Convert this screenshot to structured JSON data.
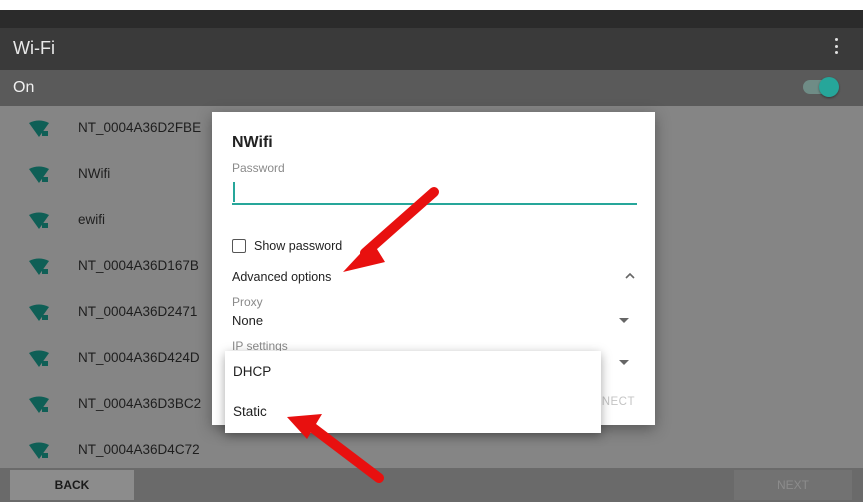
{
  "appbar": {
    "title": "Wi-Fi",
    "menu_icon": "more-vert-icon"
  },
  "wifi_toggle": {
    "label": "On",
    "state": "on"
  },
  "networks": [
    {
      "name": "NT_0004A36D2FBE"
    },
    {
      "name": "NWifi"
    },
    {
      "name": "ewifi"
    },
    {
      "name": "NT_0004A36D167B"
    },
    {
      "name": "NT_0004A36D2471"
    },
    {
      "name": "NT_0004A36D424D"
    },
    {
      "name": "NT_0004A36D3BC2"
    },
    {
      "name": "NT_0004A36D4C72"
    }
  ],
  "bottom": {
    "back_label": "BACK",
    "next_label": "NEXT"
  },
  "dialog": {
    "title": "NWifi",
    "password_label": "Password",
    "password_value": "",
    "show_password_label": "Show password",
    "advanced_label": "Advanced options",
    "proxy_label": "Proxy",
    "proxy_value": "None",
    "ip_label": "IP settings",
    "connect_label": "NECT"
  },
  "dropdown": {
    "options": [
      "DHCP",
      "Static"
    ]
  },
  "colors": {
    "accent": "#26a69a",
    "annotation_arrow": "#e8100f"
  }
}
